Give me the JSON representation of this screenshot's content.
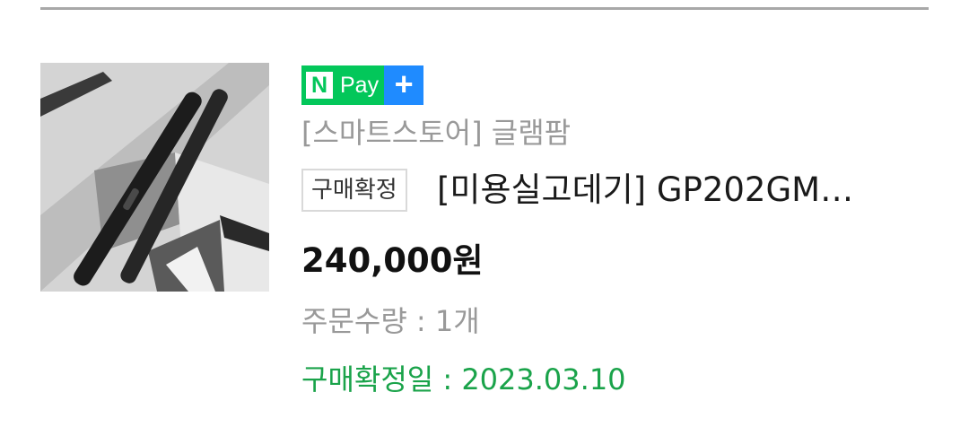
{
  "badge": {
    "n_mark": "N",
    "pay_label": "Pay",
    "plus_mark": "+"
  },
  "order": {
    "store": "[스마트스토어] 글램팜",
    "status_tag": "구매확정",
    "product_title": "[미용실고데기] GP202GM…",
    "price": "240,000원",
    "quantity": "주문수량 : 1개",
    "confirm_date": "구매확정일 : 2023.03.10"
  },
  "colors": {
    "npay_green": "#03c75a",
    "npay_blue": "#1f8bff",
    "confirm_date_green": "#1aa34a",
    "muted_gray": "#999999"
  },
  "icons": {
    "thumbnail": "hair-straightener-product-photo"
  }
}
